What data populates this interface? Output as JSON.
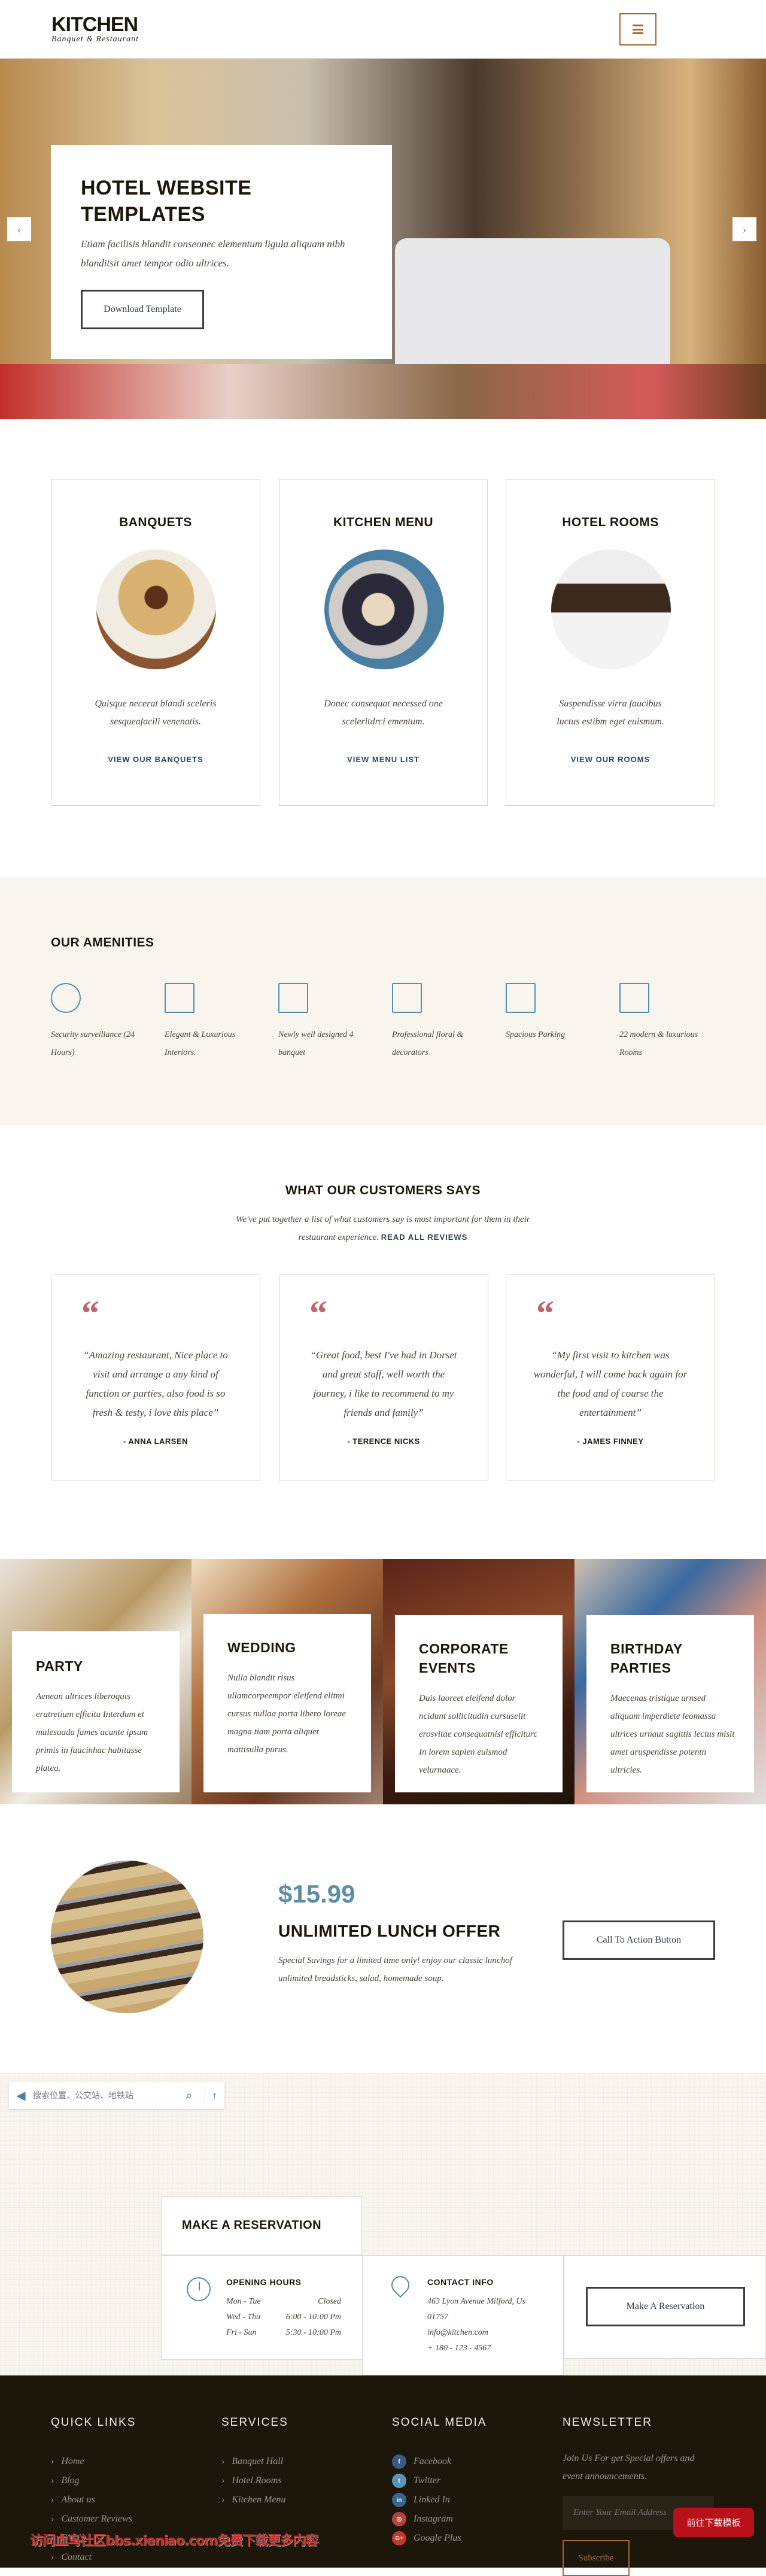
{
  "header": {
    "logo_title": "KITCHEN",
    "logo_subtitle": "Banquet & Restaurant",
    "menu_icon": "hamburger-icon",
    "accent": "#a0673d"
  },
  "hero": {
    "title_line1": "HOTEL WEBSITE",
    "title_line2": "TEMPLATES",
    "text": "Etiam facilisis blandit conseonec elementum ligula aliquam nibh blanditsit amet tempor odio ultrices.",
    "button": "Download Template",
    "prev_icon": "chevron-left-icon",
    "next_icon": "chevron-right-icon"
  },
  "services": [
    {
      "title": "BANQUETS",
      "text": "Quisque necerat blandi sceleris sesqueafacili venenatis.",
      "link": "VIEW OUR BANQUETS"
    },
    {
      "title": "KITCHEN MENU",
      "text": "Donec consequat necessed one sceleritdrci ementum.",
      "link": "VIEW MENU LIST"
    },
    {
      "title": "HOTEL ROOMS",
      "text": "Suspendisse virra faucibus luctus estibm eget euismum.",
      "link": "VIEW OUR ROOMS"
    }
  ],
  "amenities": {
    "title": "OUR AMENITIES",
    "icon_color": "#5b8ea6",
    "items": [
      {
        "icon": "security-guard-icon",
        "text": "Security surveillance (24 Hours)"
      },
      {
        "icon": "floor-plan-icon",
        "text": "Elegant & Luxurious Interiors."
      },
      {
        "icon": "building-icon",
        "text": "Newly well designed 4 banquet"
      },
      {
        "icon": "stage-curtain-icon",
        "text": "Professional floral & decorators"
      },
      {
        "icon": "parking-icon",
        "text": "Spacious Parking"
      },
      {
        "icon": "hotel-room-icon",
        "text": "22 modern & luxurious Rooms"
      }
    ]
  },
  "testimonials": {
    "title": "WHAT OUR CUSTOMERS SAYS",
    "subtitle": "We've put together a list of what customers say is most important for them in their restaurant experience.",
    "read_all": "READ ALL REVIEWS",
    "quote_color": "#c0636e",
    "items": [
      {
        "text": "“Amazing restaurant, Nice place to visit and arrange a any kind of function or parties, also food is so fresh & testy, i love this place”",
        "author": "- ANNA LARSEN"
      },
      {
        "text": "“Great food, best I've had in Dorset and great staff, well worth the journey, i like to recommend to my friends and family”",
        "author": "- TERENCE NICKS"
      },
      {
        "text": "“My first visit to kitchen was wonderful, I will come back again for the food and of course the entertainment”",
        "author": "- JAMES FINNEY"
      }
    ]
  },
  "events": [
    {
      "title": "PARTY",
      "text": "Aenean ultrices liberoquis eratretium efficitu Interdum et malesuada fames acante ipsum primis in faucinhac habitasse platea."
    },
    {
      "title": "WEDDING",
      "text": "Nulla blandit risus ullamcorpeempor eleifend elitmi cursus nullaa porta libero loreae magna tiam porta aliquet mattisulla purus."
    },
    {
      "title": "CORPORATE EVENTS",
      "text": "Duis laoreet eleifend dolor ncidunt sollicitudin cursuselit erosvitae consequatnisl efficiturc In lorem sapien euismod velurnaace."
    },
    {
      "title": "BIRTHDAY PARTIES",
      "text": "Maecenas tristique urnsed aliquam imperdiete leomassa ultrices urnaut sagittis lectus misit amet aruspendisse potentn ultricies."
    }
  ],
  "offer": {
    "price": "$15.99",
    "price_color": "#5b8ea6",
    "title": "UNLIMITED LUNCH OFFER",
    "text": "Special Savings for a limited time only! enjoy our classic lunchof unlimited breadsticks, salad, homemade soup.",
    "button": "Call To Action Button"
  },
  "map_widget": {
    "placeholder": "搜索位置、公交站、地铁站",
    "search_icon": "search-icon",
    "nav_icon": "navigation-arrow-icon"
  },
  "reservation": {
    "title": "MAKE A RESERVATION",
    "hours": {
      "title": "OPENING HOURS",
      "icon": "clock-icon",
      "rows": [
        {
          "day": "Mon - Tue",
          "time": "Closed"
        },
        {
          "day": "Wed - Thu",
          "time": "6:00 - 10:00 Pm"
        },
        {
          "day": "Fri - Sun",
          "time": "5:30 - 10:00 Pm"
        }
      ]
    },
    "contact": {
      "title": "CONTACT INFO",
      "icon": "location-pin-icon",
      "address": "463 Lyon Avenue Milford, Us 01757",
      "email": "info@kitchen.com",
      "phone": "+ 180 - 123 - 4567"
    },
    "button": "Make A Reservation"
  },
  "footer": {
    "quick_links": {
      "title": "QUICK LINKS",
      "items": [
        "Home",
        "Blog",
        "About us",
        "Customer Reviews",
        "FAQ's",
        "Contact"
      ]
    },
    "services": {
      "title": "SERVICES",
      "items": [
        "Banquet Hall",
        "Hotel Rooms",
        "Kitchen Menu"
      ]
    },
    "social": {
      "title": "SOCIAL MEDIA",
      "items": [
        {
          "label": "Facebook",
          "icon": "facebook-icon",
          "glyph": "f",
          "color": "#3b5b85"
        },
        {
          "label": "Twitter",
          "icon": "twitter-icon",
          "glyph": "t",
          "color": "#5a96b3"
        },
        {
          "label": "Linked In",
          "icon": "linkedin-icon",
          "glyph": "in",
          "color": "#3a6590"
        },
        {
          "label": "Instagram",
          "icon": "instagram-icon",
          "glyph": "◎",
          "color": "#b5443a"
        },
        {
          "label": "Google Plus",
          "icon": "google-plus-icon",
          "glyph": "G+",
          "color": "#c0392b"
        }
      ]
    },
    "newsletter": {
      "title": "NEWSLETTER",
      "text": "Join Us For get Special offers and event announcements.",
      "placeholder": "Enter Your Email Address",
      "button": "Subscribe"
    },
    "bg": "#1d170b"
  },
  "overlay": {
    "download_button": "前往下载模板",
    "watermark": "访问血鸟社区bbs.xieniao.com免费下载更多内容"
  }
}
